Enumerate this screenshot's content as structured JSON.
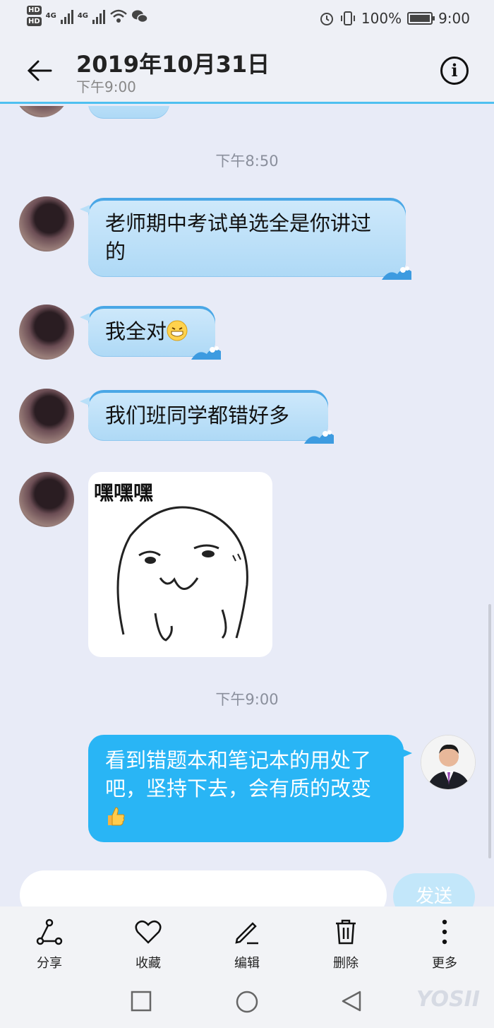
{
  "status_bar": {
    "hd1": "HD",
    "hd2": "HD",
    "net1": "4G",
    "net2": "4G",
    "battery_percent": "100%",
    "clock": "9:00"
  },
  "header": {
    "title": "2019年10月31日",
    "subtitle": "下午9:00"
  },
  "chat": {
    "time_1": "下午8:50",
    "messages": [
      {
        "text": "老师期中考试单选全是你讲过的"
      },
      {
        "text": "我全对"
      },
      {
        "text": "我们班同学都错好多"
      }
    ],
    "sticker_text": "嘿嘿嘿",
    "time_2": "下午9:00",
    "reply": "看到错题本和笔记本的用处了吧，坚持下去，会有质的改变"
  },
  "input": {
    "send_label": "发送"
  },
  "toolbar": {
    "share": "分享",
    "favorite": "收藏",
    "edit": "编辑",
    "delete": "删除",
    "more": "更多"
  },
  "watermark": "YOSII",
  "colors": {
    "accent": "#29b5f5",
    "incoming_bubble": "#b9dff8",
    "background": "#e8ebf7"
  }
}
